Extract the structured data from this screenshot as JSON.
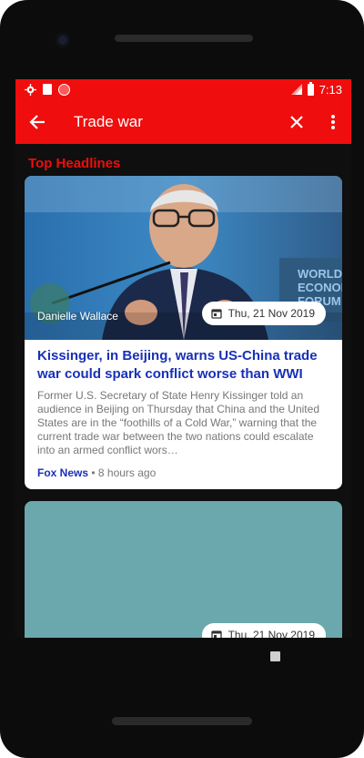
{
  "statusbar": {
    "time": "7:13"
  },
  "appbar": {
    "title": "Trade war"
  },
  "section": {
    "title": "Top Headlines"
  },
  "articles": [
    {
      "author": "Danielle Wallace",
      "date": "Thu, 21 Nov 2019",
      "headline": "Kissinger, in Beijing, warns US-China trade war could spark conflict worse than WWI",
      "summary": "Former U.S. Secretary of State Henry Kissinger told an audience in Beijing on Thursday that China and the United States are in the “foothills of a Cold War,” warning that the current trade war between the two nations could escalate into an armed conflict wors…",
      "source": "Fox News",
      "time_ago": "• 8 hours ago",
      "image_backdrop_text": "WORLD\nECONOM\nFORUM"
    },
    {
      "date": "Thu, 21 Nov 2019"
    }
  ]
}
